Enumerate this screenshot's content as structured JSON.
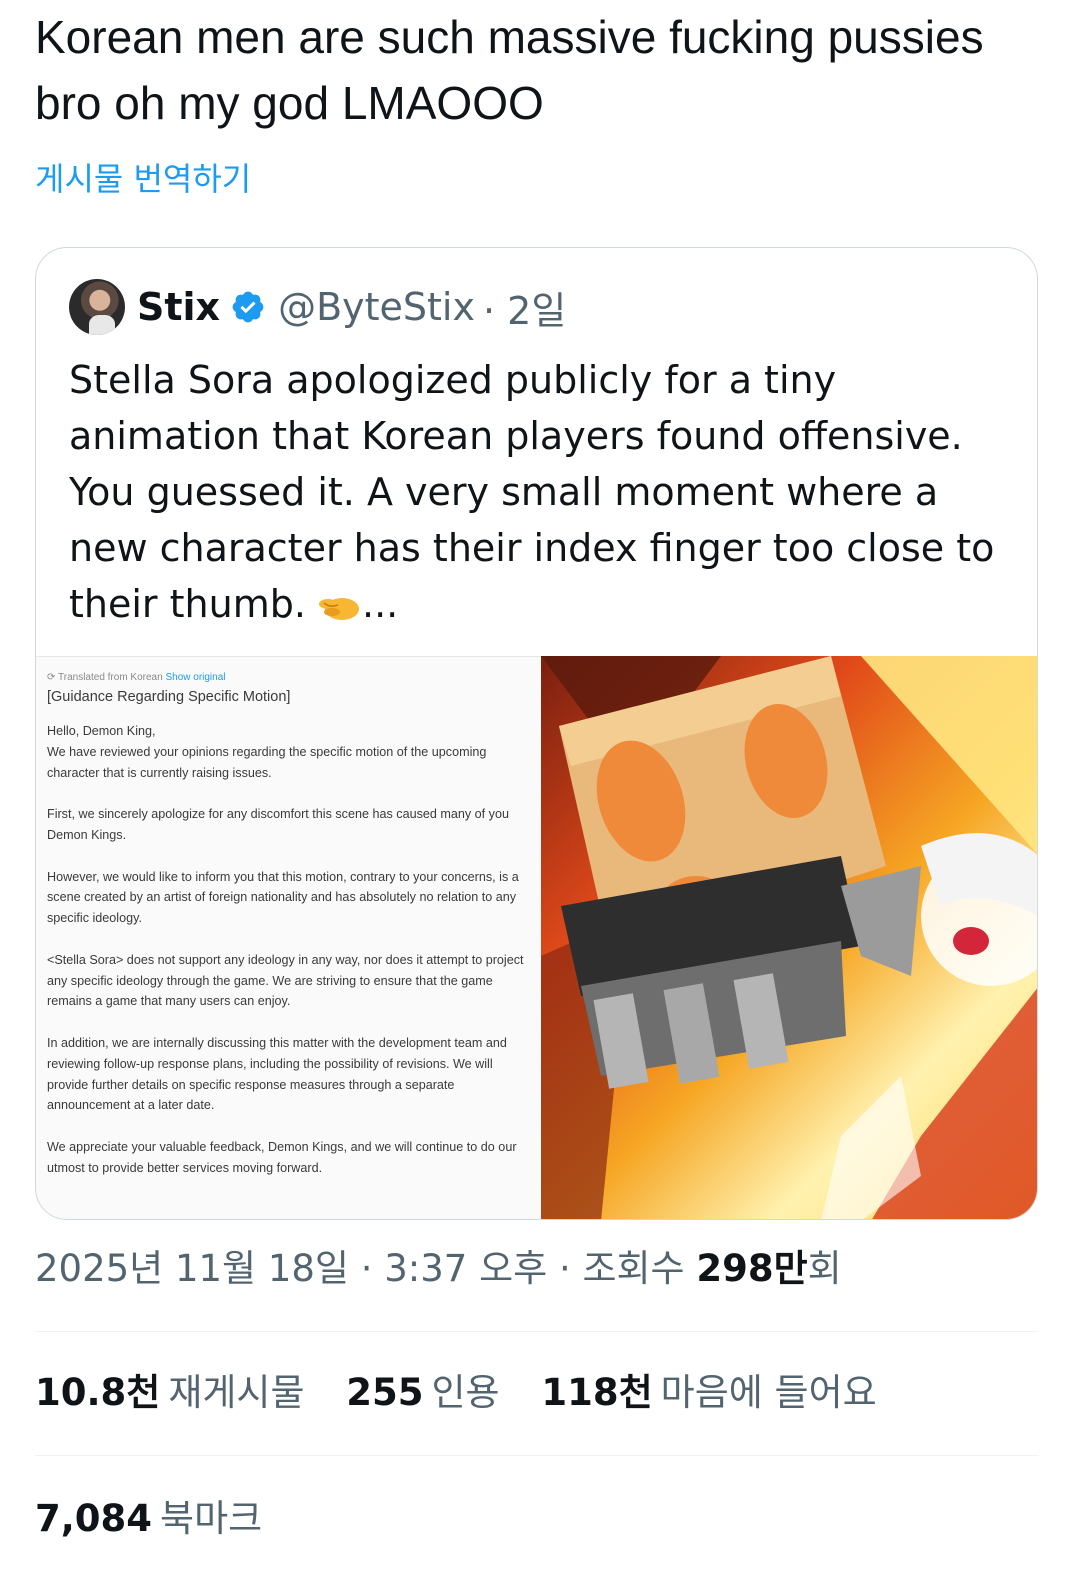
{
  "tweet": {
    "text": "Korean men are such massive fucking pussies bro oh my god LMAOOO",
    "translate_label": "게시물 번역하기"
  },
  "quote": {
    "name": "Stix",
    "handle": "@ByteStix",
    "time": "· 2일",
    "text": "Stella Sora apologized publicly for a tiny animation that Korean players found offensive. You guessed it. A very small moment where a new character has their index finger too close to their thumb.",
    "text_suffix": "...",
    "emoji_icon": "pinching-hand-icon",
    "verified_icon": "verified-badge-icon",
    "media": {
      "doc_meta": "Translated from Korean",
      "doc_show": "Show original",
      "doc_title": "[Guidance Regarding Specific Motion]",
      "doc_paragraphs": [
        "Hello, Demon King,\nWe have reviewed your opinions regarding the specific motion of the upcoming character that is currently raising issues.",
        "First, we sincerely apologize for any discomfort this scene has caused many of you Demon Kings.",
        "However, we would like to inform you that this motion, contrary to your concerns, is a scene created by an artist of foreign nationality and has absolutely no relation to any specific ideology.",
        "<Stella Sora> does not support any ideology in any way, nor does it attempt to project any specific ideology through the game. We are striving to ensure that the game remains a game that many users can enjoy.",
        "In addition, we are internally discussing this matter with the development team and reviewing follow-up response plans, including the possibility of revisions. We will provide further details on specific response measures through a separate announcement at a later date.",
        "We appreciate your valuable feedback, Demon Kings, and we will continue to do our utmost to provide better services moving forward."
      ]
    }
  },
  "meta": {
    "date": "2025년 11월 18일 · 3:37 오후 · 조회수",
    "views_value": "298만",
    "views_suffix": "회"
  },
  "stats": {
    "reposts_value": "10.8천",
    "reposts_label": "재게시물",
    "quotes_value": "255",
    "quotes_label": "인용",
    "likes_value": "118천",
    "likes_label": "마음에 들어요",
    "bookmarks_value": "7,084",
    "bookmarks_label": "북마크"
  },
  "colors": {
    "link": "#1d9bf0",
    "secondary": "#536471",
    "primary": "#0f1419",
    "border": "#cfd9de"
  }
}
